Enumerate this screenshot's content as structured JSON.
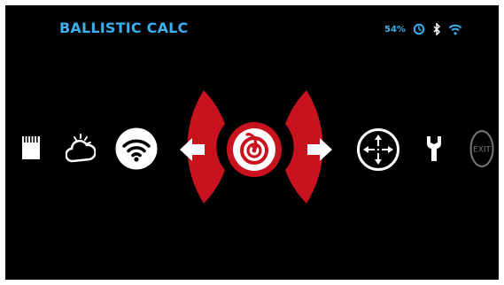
{
  "header": {
    "title": "BALLISTIC CALC",
    "battery": "54%",
    "status_icons": [
      "timer-icon",
      "bluetooth-icon",
      "wifi-status-icon"
    ]
  },
  "carousel": {
    "items": [
      {
        "name": "sd-card-icon"
      },
      {
        "name": "weather-icon"
      },
      {
        "name": "wifi-icon"
      },
      {
        "name": "previous-arrow-button"
      },
      {
        "name": "ballistic-calc-icon",
        "selected": true
      },
      {
        "name": "next-arrow-button"
      },
      {
        "name": "reticle-icon"
      },
      {
        "name": "wrench-icon"
      },
      {
        "name": "exit-button",
        "label": "EXIT"
      }
    ]
  },
  "colors": {
    "accent": "#3ab0f0",
    "selection": "#c8121d",
    "background": "#000000",
    "icon": "#ffffff"
  }
}
